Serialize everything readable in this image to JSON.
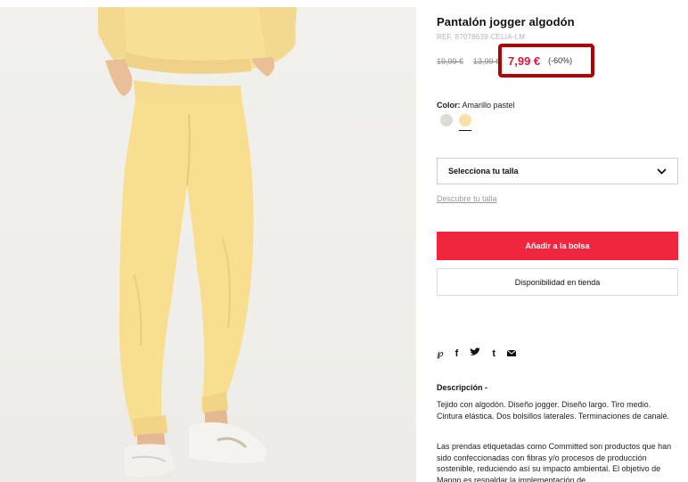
{
  "product": {
    "image_alt": "yellow cotton jogger pants",
    "title": "Pantalón jogger algodón",
    "ref": "REF. 87078639-CELIA-LM",
    "price_original": "19,99 €",
    "price_previous": "13,99 €",
    "price_current": "7,99 €",
    "discount": "(-60%)",
    "highlight_color": "#b30000",
    "price_color": "#e5143d"
  },
  "color": {
    "label": "Color:",
    "value": "Amarillo pastel",
    "swatches": [
      {
        "name": "gris",
        "hex": "#dcdcd6"
      },
      {
        "name": "amarillo pastel",
        "hex": "#f8e0a8",
        "selected": true
      }
    ]
  },
  "size": {
    "select_label": "Selecciona tu talla",
    "guide_link": "Descubre tu talla"
  },
  "actions": {
    "add_to_bag": "Añadir a la bolsa",
    "store_availability": "Disponibilidad en tienda",
    "accent": "#f0263e"
  },
  "share": {
    "icons": [
      "pinterest-icon",
      "facebook-icon",
      "twitter-icon",
      "tumblr-icon",
      "email-icon"
    ]
  },
  "description": {
    "title": "Descripción -",
    "text1": "Tejido con algodón. Diseño jogger. Diseño largo. Tiro medio. Cintura elástica. Dos bolsillos laterales. Terminaciones de canalé.",
    "text2": "Las prendas etiquetadas como Committed son productos que han sido confeccionadas con fibras y/o procesos de producción sostenible, reduciendo así su impacto ambiental. El objetivo de Mango es respaldar la implementación de"
  }
}
